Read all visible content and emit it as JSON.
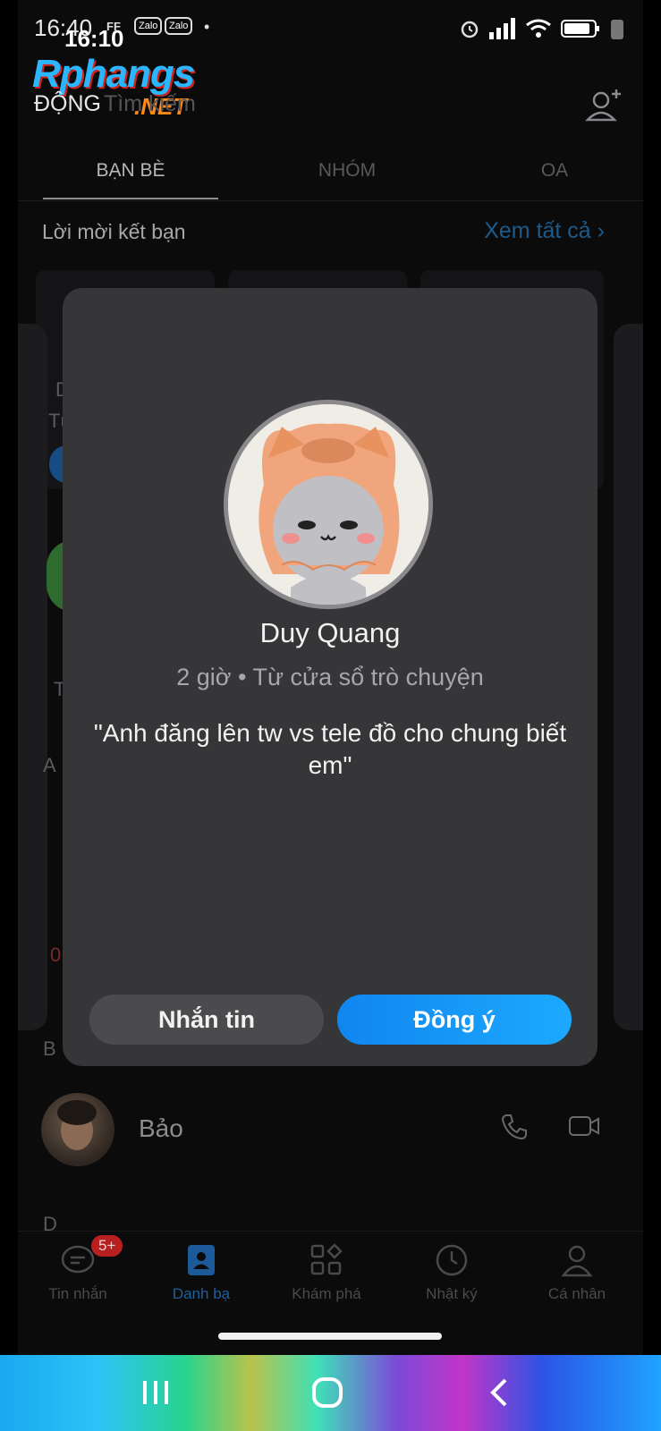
{
  "status_bar": {
    "time_back": "16:40",
    "time_front": "16:10",
    "badge_ff": "FF",
    "badge_zalo_1": "Zalo",
    "badge_zalo_2": "Zalo"
  },
  "watermark": {
    "logo_main": "Rphangs",
    "logo_suffix": ".NET",
    "logo_sub": "ĐỘNG"
  },
  "search": {
    "placeholder": "Tìm kiếm"
  },
  "tabs": [
    {
      "label": "BẠN BÈ",
      "active": true
    },
    {
      "label": "NHÓM",
      "active": false
    },
    {
      "label": "OA",
      "active": false
    }
  ],
  "friend_requests": {
    "title": "Lời mời kết bạn",
    "see_all": "Xem tất cả"
  },
  "ghost_letters": {
    "d": "D",
    "tu": "Tù",
    "t": "T",
    "a": "A",
    "zero": "0"
  },
  "contacts": {
    "section_b": "B",
    "section_d": "D",
    "items": [
      {
        "name": "Bảo"
      }
    ]
  },
  "bottom_nav": [
    {
      "label": "Tin nhắn",
      "icon": "chat-icon",
      "badge": "5+"
    },
    {
      "label": "Danh bạ",
      "icon": "contacts-icon",
      "active": true
    },
    {
      "label": "Khám phá",
      "icon": "discover-icon"
    },
    {
      "label": "Nhật ký",
      "icon": "clock-icon"
    },
    {
      "label": "Cá nhân",
      "icon": "person-icon"
    }
  ],
  "modal": {
    "name": "Duy Quang",
    "subtitle": "2 giờ • Từ cửa sổ trò chuyện",
    "message": "\"Anh đăng lên tw vs tele đồ cho chung biết em\"",
    "btn_message": "Nhắn tin",
    "btn_accept": "Đồng ý"
  },
  "colors": {
    "accent": "#1a9bff",
    "modal_bg": "#363638",
    "badge_red": "#b82020"
  }
}
